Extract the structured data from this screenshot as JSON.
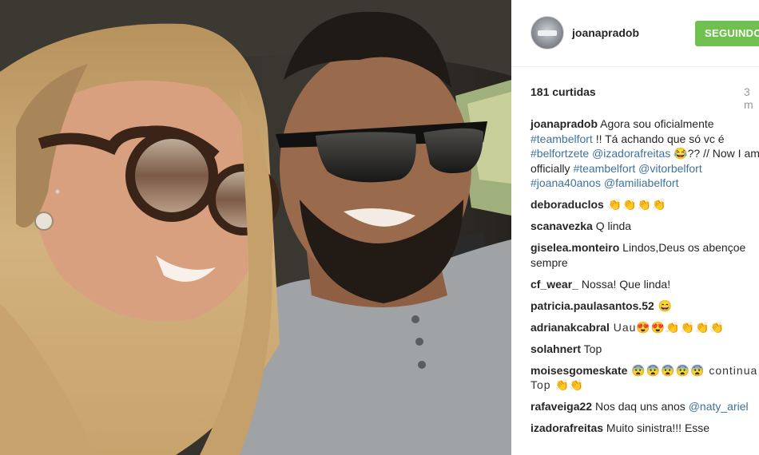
{
  "post": {
    "username": "joanapradob",
    "follow_label": "SEGUINDO",
    "likes": "181 curtidas",
    "time": "3 m"
  },
  "caption": {
    "user": "joanapradob",
    "t1": " Agora sou oficialmente ",
    "h1": "#teambelfort",
    "t2": " !! Tá achando que só vc é ",
    "h2": "#belfortzete",
    "t3": " ",
    "h3": "@izadorafreitas",
    "t4": " 😂?? // Now I am officially ",
    "h4": "#teambelfort",
    "t5": " ",
    "h5": "@vitorbelfort",
    "t6": " ",
    "h6": "#joana40anos",
    "t7": " ",
    "h7": "@familiabelfort"
  },
  "comments": [
    {
      "user": "deboraduclos",
      "text": " 👏👏👏👏"
    },
    {
      "user": "scanavezka",
      "text": " Q linda"
    },
    {
      "user": "giselea.monteiro",
      "text": " Lindos,Deus os abençoe sempre"
    },
    {
      "user": "cf_wear_",
      "text": " Nossa! Que linda!"
    },
    {
      "user": "patricia.paulasantos.52",
      "text": " 😄"
    },
    {
      "user": "adrianakcabral",
      "text": " Uau😍😍👏👏👏👏"
    },
    {
      "user": "solahnert",
      "text": " Top"
    },
    {
      "user": "moisesgomeskate",
      "text": " 😨😨😨😨😨 continua Top 👏👏"
    },
    {
      "user": "rafaveiga22",
      "text": " Nos daq uns anos "
    },
    {
      "user": "izadorafreitas",
      "text": " Muito sinistra!!! Esse"
    }
  ],
  "comment8_mention": "@naty_ariel",
  "icons": {
    "avatar": "profile-avatar",
    "photo": "selfie-photo"
  }
}
